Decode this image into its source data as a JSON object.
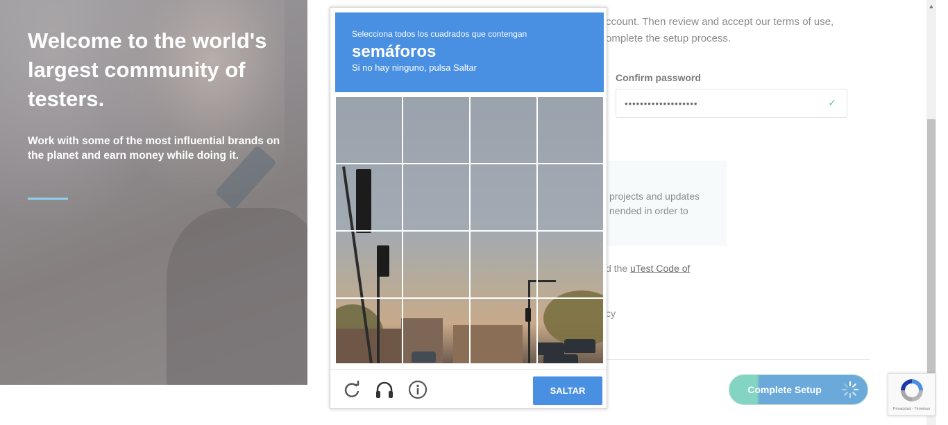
{
  "hero": {
    "title": "Welcome to the world's largest community of testers.",
    "subtitle": "Work with some of the most influential brands on the planet and earn money while doing it."
  },
  "form": {
    "intro_text": "ccount. Then review and accept our terms of use, omplete the setup process.",
    "confirm_password_label": "Confirm password",
    "confirm_password_value": "•••••••••••••••••••",
    "info_text": "projects and updates nended in order to",
    "code_prefix": "d the ",
    "code_link": "uTest Code of",
    "privacy_text": "cy",
    "complete_button": "Complete Setup"
  },
  "captcha": {
    "instruction": "Selecciona todos los cuadrados que contengan",
    "target": "semáforos",
    "hint": "Si no hay ninguno, pulsa Saltar",
    "skip_button": "SALTAR",
    "icons": [
      "reload-icon",
      "audio-icon",
      "info-icon"
    ]
  },
  "recaptcha_badge": {
    "links": "Privacidad - Términos"
  },
  "colors": {
    "captcha_blue": "#4a90e2",
    "accent_line": "#8fd0ee",
    "button_teal": "#83d4c1",
    "button_blue": "#6aa9d9"
  }
}
